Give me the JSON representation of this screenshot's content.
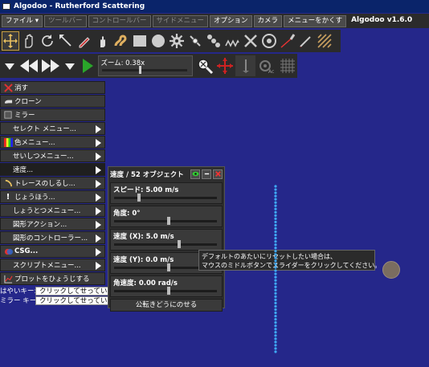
{
  "window": {
    "title": "Algodoo - Rutherford Scattering"
  },
  "menubar": {
    "items": [
      {
        "label": "ファイル ▾",
        "enabled": true
      },
      {
        "label": "ツールバー",
        "enabled": false
      },
      {
        "label": "コントロールバー",
        "enabled": false
      },
      {
        "label": "サイドメニュー",
        "enabled": false
      },
      {
        "label": "オプション",
        "enabled": true
      },
      {
        "label": "カメラ",
        "enabled": true
      },
      {
        "label": "メニューをかくす",
        "enabled": true
      }
    ],
    "version": "Algodoo v1.6.0"
  },
  "toolbar": {
    "tools": [
      "move-tool-icon",
      "drag-hand-icon",
      "rotate-icon",
      "scale-arrow-icon",
      "pencil-icon",
      "cut-hand-icon",
      "rope-icon",
      "box-icon",
      "circle-icon",
      "gear-icon",
      "hinge-icon",
      "chain-icon",
      "spring-icon",
      "fixate-icon",
      "wheel-icon",
      "laser-icon",
      "brush-icon",
      "hatch-icon"
    ],
    "selected": 0
  },
  "playbar": {
    "zoom_label": "ズーム: 0.38x",
    "zoom_fraction": 0.38
  },
  "context_menu": {
    "items": [
      {
        "label": "消す",
        "icon": "delete-x-icon",
        "submenu": false,
        "bold": false
      },
      {
        "label": "クローン",
        "icon": "clone-icon",
        "submenu": false,
        "bold": false
      },
      {
        "label": "ミラー",
        "icon": "mirror-icon",
        "submenu": false,
        "bold": false
      },
      {
        "label": "セレクト メニュー...",
        "icon": "",
        "submenu": true,
        "bold": false
      },
      {
        "label": "色メニュー...",
        "icon": "color-palette-icon",
        "submenu": true,
        "bold": false
      },
      {
        "label": "せいしつメニュー...",
        "icon": "",
        "submenu": true,
        "bold": false
      },
      {
        "label": "速度...",
        "icon": "",
        "submenu": true,
        "bold": false,
        "highlight": true
      },
      {
        "label": "トレースのしるし...",
        "icon": "trace-icon",
        "submenu": true,
        "bold": false
      },
      {
        "label": "じょうほう...",
        "icon": "info-icon",
        "submenu": true,
        "bold": false
      },
      {
        "label": "しょうとつメニュー...",
        "icon": "",
        "submenu": true,
        "bold": false
      },
      {
        "label": "図形アクション...",
        "icon": "",
        "submenu": true,
        "bold": false
      },
      {
        "label": "図形のコントローラー...",
        "icon": "",
        "submenu": true,
        "bold": false
      },
      {
        "label": "CSG...",
        "icon": "csg-icon",
        "submenu": true,
        "bold": true
      },
      {
        "label": "スクリプトメニュー...",
        "icon": "",
        "submenu": true,
        "bold": false
      },
      {
        "label": "プロットをひょうじする",
        "icon": "plot-icon",
        "submenu": false,
        "bold": false
      }
    ],
    "keys": [
      {
        "label": "はやいキー:",
        "value": "クリックしてせってい"
      },
      {
        "label": "ミラー キー:",
        "value": "クリックしてせってい"
      }
    ]
  },
  "velocity_panel": {
    "title": "速度 / 52 オブジェクト",
    "sliders": [
      {
        "label": "スピード: 5.00 m/s",
        "fraction": 0.22
      },
      {
        "label": "角度: 0°",
        "fraction": 0.5
      },
      {
        "label": "速度 (X): 5.0 m/s",
        "fraction": 0.6
      },
      {
        "label": "速度 (Y): 0.0 m/s",
        "fraction": 0.5
      },
      {
        "label": "角速度: 0.00 rad/s",
        "fraction": 0.5
      }
    ],
    "orbit_button": "公転きどうにのせる"
  },
  "tooltip": {
    "line1": "デフォルトのあたいにリセットしたい場合は、",
    "line2": "マウスのミドルボタンでスライダーをクリックしてください。"
  },
  "colors": {
    "background": "#25278a",
    "dots": "#3fa9f5",
    "ball": "#7a6d60"
  }
}
